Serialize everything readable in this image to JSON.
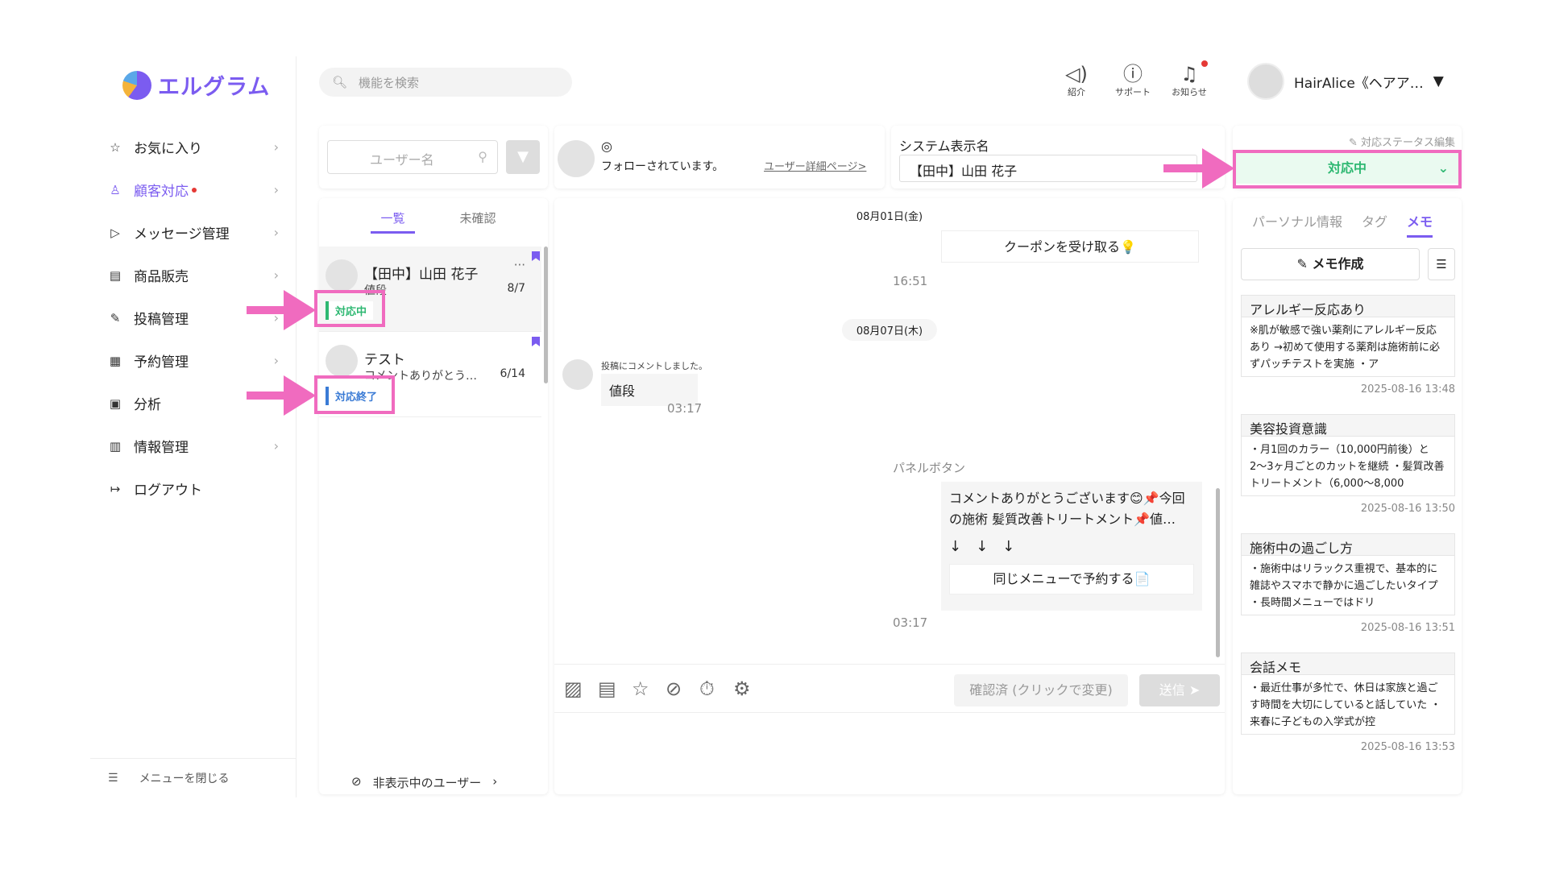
{
  "app": {
    "logo_text": "エルグラム"
  },
  "sidebar": {
    "items": [
      {
        "label": "お気に入り",
        "icon": "star-icon"
      },
      {
        "label": "顧客対応",
        "icon": "user-icon"
      },
      {
        "label": "メッセージ管理",
        "icon": "send-icon"
      },
      {
        "label": "商品販売",
        "icon": "store-icon"
      },
      {
        "label": "投稿管理",
        "icon": "edit-icon"
      },
      {
        "label": "予約管理",
        "icon": "calendar-icon"
      },
      {
        "label": "分析",
        "icon": "report-icon"
      },
      {
        "label": "情報管理",
        "icon": "chart-icon"
      },
      {
        "label": "ログアウト",
        "icon": "logout-icon"
      }
    ],
    "collapse_label": "メニューを閉じる"
  },
  "header": {
    "search_placeholder": "機能を検索",
    "icons": [
      {
        "label": "紹介",
        "icon": "megaphone-icon"
      },
      {
        "label": "サポート",
        "icon": "help-icon"
      },
      {
        "label": "お知らせ",
        "icon": "bell-icon"
      }
    ],
    "user_name": "HairAlice《ヘアア…"
  },
  "filter": {
    "username_placeholder": "ユーザー名"
  },
  "list": {
    "tabs": [
      "一覧",
      "未確認"
    ],
    "conversations": [
      {
        "name": "【田中】山田 花子",
        "preview": "値段",
        "date": "8/7",
        "status": "対応中"
      },
      {
        "name": "テスト",
        "preview": "コメントありがとう…",
        "date": "6/14",
        "status": "対応終了"
      }
    ],
    "hidden_users_label": "非表示中のユーザー"
  },
  "profile": {
    "follow_text": "フォローされています。",
    "detail_link": "ユーザー詳細ページ>"
  },
  "sysname": {
    "label": "システム表示名",
    "value": "【田中】山田 花子"
  },
  "status": {
    "edit_label": "対応ステータス編集",
    "value": "対応中"
  },
  "chat": {
    "date1": "08月01日(金)",
    "coupon_button": "クーポンを受け取る💡",
    "time1": "16:51",
    "date2": "08月07日(木)",
    "comment_note": "投稿にコメントしました。",
    "comment_text": "値段",
    "time2": "03:17",
    "panel_label": "パネルボタン",
    "reply_text": "コメントありがとうございます😊📌今回の施術 髪質改善トリートメント📌値…",
    "reply_arrows": "↓　↓　↓",
    "reserve_button": "同じメニューで予約する📄",
    "time3": "03:17",
    "confirm_button": "確認済 (クリックで変更)",
    "send_button": "送信 ➤"
  },
  "memo": {
    "tabs": [
      "パーソナル情報",
      "タグ",
      "メモ"
    ],
    "create_label": "メモ作成",
    "cards": [
      {
        "title": "アレルギー反応あり",
        "body": "※肌が敏感で強い薬剤にアレルギー反応あり →初めて使用する薬剤は施術前に必ずパッチテストを実施 ・ア",
        "date": "2025-08-16 13:48"
      },
      {
        "title": "美容投資意識",
        "body": "・月1回のカラー（10,000円前後）と2〜3ヶ月ごとのカットを継続 ・髪質改善トリートメント（6,000〜8,000",
        "date": "2025-08-16 13:50"
      },
      {
        "title": "施術中の過ごし方",
        "body": "・施術中はリラックス重視で、基本的に雑誌やスマホで静かに過ごしたいタイプ ・長時間メニューではドリ",
        "date": "2025-08-16 13:51"
      },
      {
        "title": "会話メモ",
        "body": "・最近仕事が多忙で、休日は家族と過ごす時間を大切にしていると話していた ・来春に子どもの入学式が控",
        "date": "2025-08-16 13:53"
      }
    ]
  },
  "colors": {
    "accent": "#7b5cf0",
    "annotation": "#f06bbf",
    "in_progress": "#2eb872",
    "done": "#3a7bd5"
  }
}
